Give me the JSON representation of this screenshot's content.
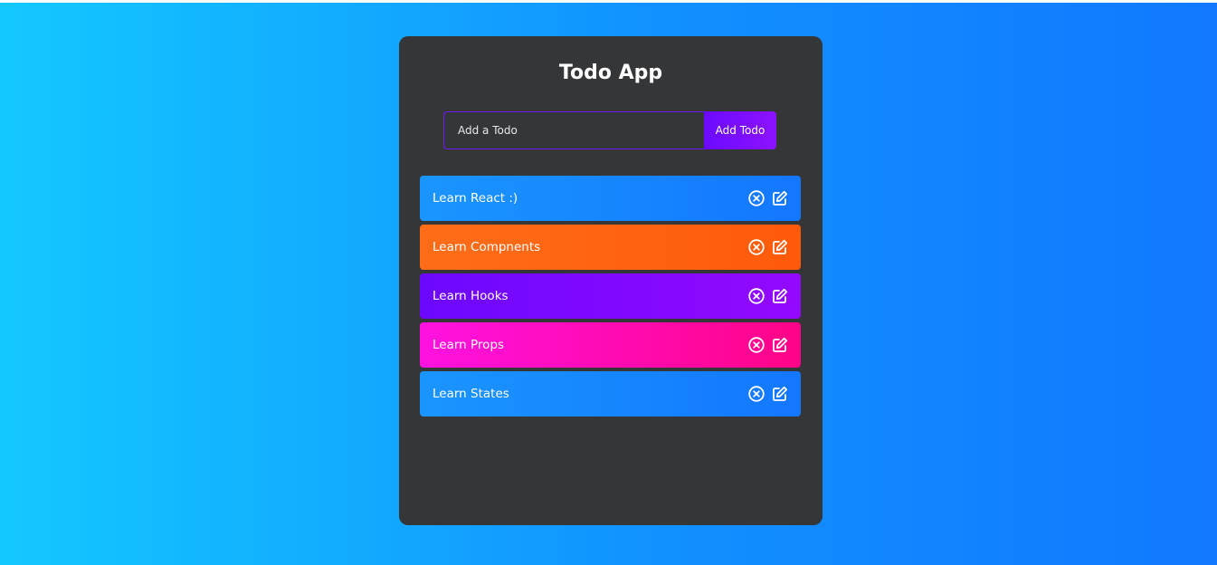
{
  "app": {
    "title": "Todo App"
  },
  "form": {
    "placeholder": "Add a Todo",
    "button_label": "Add Todo"
  },
  "todos": [
    {
      "text": "Learn React :)",
      "color": "#1a95ff"
    },
    {
      "text": "Learn Compnents",
      "color": "#ff6d18"
    },
    {
      "text": "Learn Hooks",
      "color": "#6c08ff"
    },
    {
      "text": "Learn Props",
      "color": "#ff12e0"
    },
    {
      "text": "Learn States",
      "color": "#1a95ff"
    }
  ],
  "icons": {
    "delete": "close-circle-icon",
    "edit": "edit-icon"
  },
  "colors": {
    "background_start": "#13c8ff",
    "background_end": "#1178ff",
    "panel": "#353638",
    "accent": "#6c1bff"
  }
}
